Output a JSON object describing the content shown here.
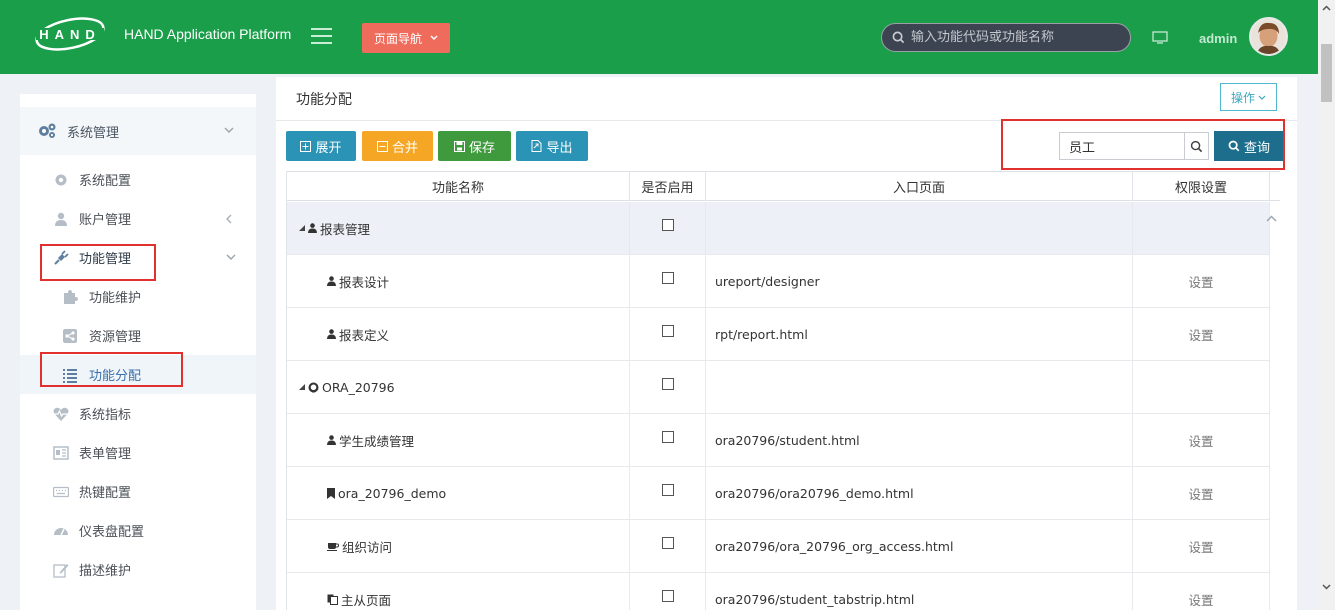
{
  "header": {
    "logo_text": "HAND",
    "app_title": "HAND Application Platform",
    "nav_button": "页面导航",
    "search_placeholder": "输入功能代码或功能名称",
    "user": "admin",
    "brand_color": "#1a9e4a"
  },
  "sidebar": {
    "group": "系统管理",
    "items": [
      {
        "label": "系统配置",
        "icon": "gear-icon"
      },
      {
        "label": "账户管理",
        "icon": "user-icon"
      },
      {
        "label": "功能管理",
        "icon": "plug-icon"
      },
      {
        "label": "功能维护",
        "icon": "puzzle-icon"
      },
      {
        "label": "资源管理",
        "icon": "share-icon"
      },
      {
        "label": "功能分配",
        "icon": "list-icon"
      },
      {
        "label": "系统指标",
        "icon": "heartbeat-icon"
      },
      {
        "label": "表单管理",
        "icon": "form-icon"
      },
      {
        "label": "热键配置",
        "icon": "keyboard-icon"
      },
      {
        "label": "仪表盘配置",
        "icon": "dashboard-icon"
      },
      {
        "label": "描述维护",
        "icon": "edit-icon"
      }
    ]
  },
  "main": {
    "title": "功能分配",
    "op_button": "操作",
    "toolbar": {
      "expand": "展开",
      "collapse": "合并",
      "save": "保存",
      "export": "导出",
      "query_value": "员工",
      "query": "查询"
    },
    "columns": [
      "功能名称",
      "是否启用",
      "入口页面",
      "权限设置"
    ],
    "rows": [
      {
        "name": "报表管理",
        "icon": "user-icon",
        "expander": true,
        "enabled": false,
        "page": "",
        "perm": ""
      },
      {
        "name": "报表设计",
        "icon": "user-icon",
        "expander": false,
        "enabled": false,
        "page": "ureport/designer",
        "perm": "设置"
      },
      {
        "name": "报表定义",
        "icon": "user-icon",
        "expander": false,
        "enabled": false,
        "page": "rpt/report.html",
        "perm": "设置"
      },
      {
        "name": "ORA_20796",
        "icon": "github-icon",
        "expander": true,
        "enabled": false,
        "page": "",
        "perm": ""
      },
      {
        "name": "学生成绩管理",
        "icon": "user-icon",
        "expander": false,
        "enabled": false,
        "page": "ora20796/student.html",
        "perm": "设置"
      },
      {
        "name": "ora_20796_demo",
        "icon": "bookmark-icon",
        "expander": false,
        "enabled": false,
        "page": "ora20796/ora20796_demo.html",
        "perm": "设置"
      },
      {
        "name": "组织访问",
        "icon": "coffee-icon",
        "expander": false,
        "enabled": false,
        "page": "ora20796/ora_20796_org_access.html",
        "perm": "设置"
      },
      {
        "name": "主从页面",
        "icon": "copy-icon",
        "expander": false,
        "enabled": false,
        "page": "ora20796/student_tabstrip.html",
        "perm": "设置"
      }
    ]
  },
  "colors": {
    "expand": "#2a93b6",
    "collapse": "#f6a625",
    "save": "#3e9a3c",
    "export": "#2a93b6",
    "query": "#1c6e8c",
    "nav": "#ef6b5b",
    "highlight": "#e0312f"
  }
}
